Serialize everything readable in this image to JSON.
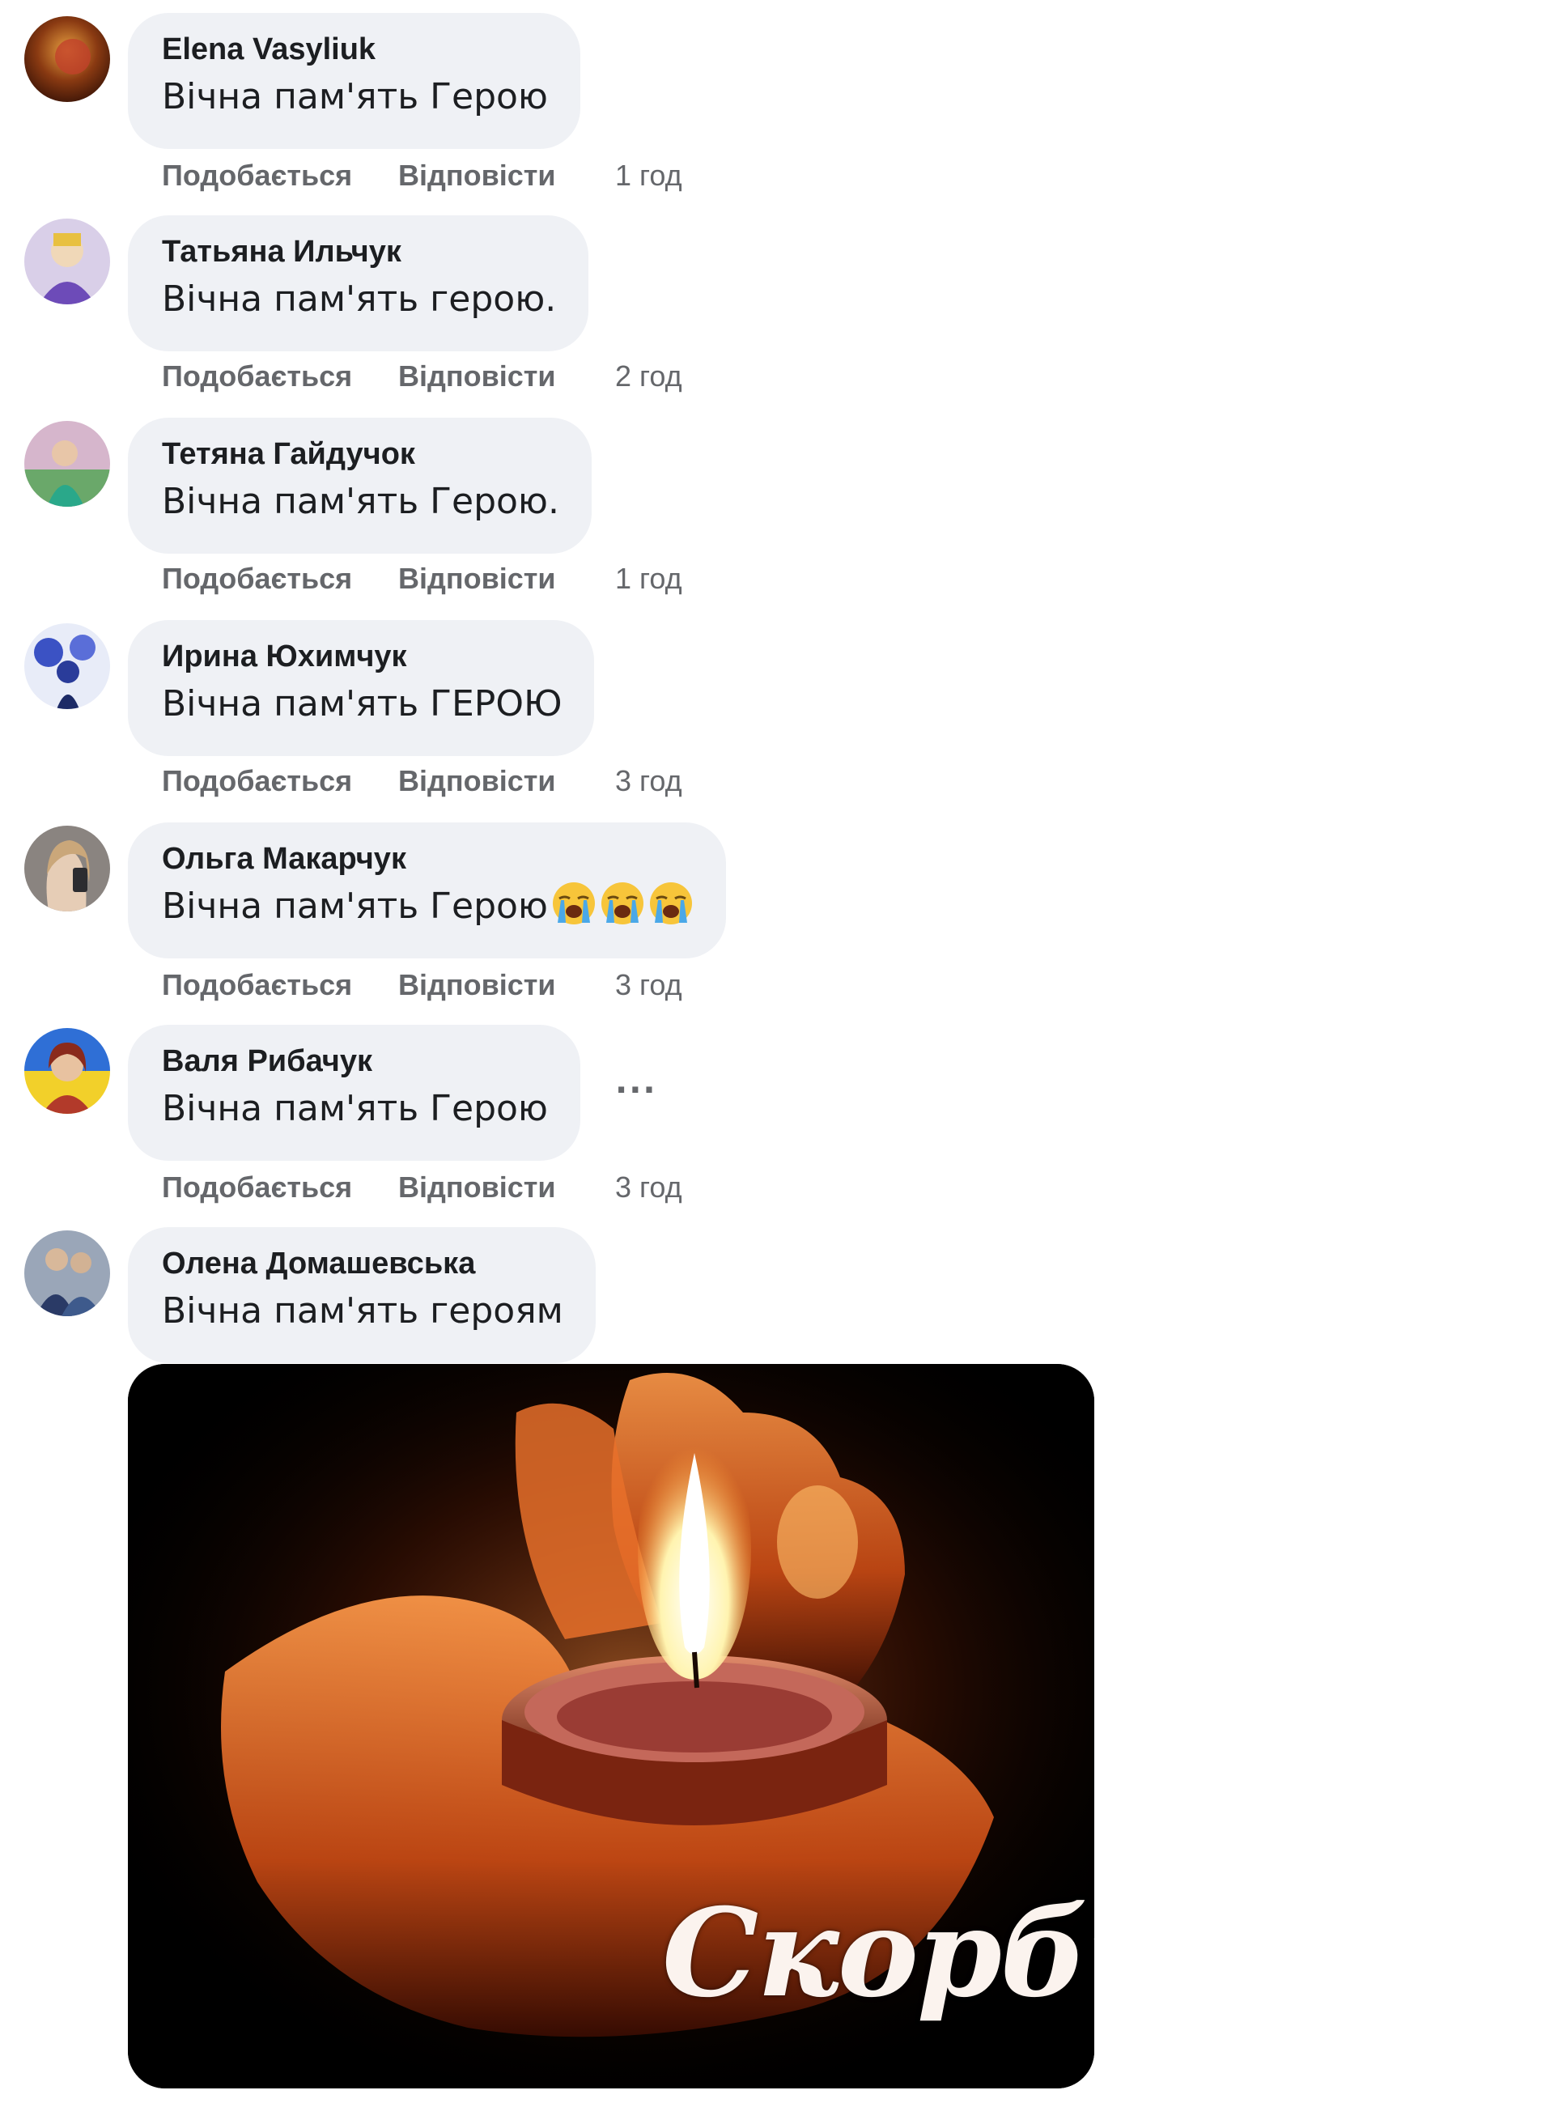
{
  "comments": [
    {
      "author": "Elena Vasyliuk",
      "text": "Вічна пам'ять Герою",
      "like": "Подобається",
      "reply": "Відповісти",
      "time": "1 год",
      "avatar_color": "#8a3a12"
    },
    {
      "author": "Татьяна Ильчук",
      "text": "Вічна пам'ять герою.",
      "like": "Подобається",
      "reply": "Відповісти",
      "time": "2 год",
      "avatar_color": "#6d4bb8"
    },
    {
      "author": "Тетяна Гайдучок",
      "text": "Вічна пам'ять Герою.",
      "like": "Подобається",
      "reply": "Відповісти",
      "time": "1 год",
      "avatar_color": "#2aa88a"
    },
    {
      "author": "Ирина Юхимчук",
      "text": "Вічна пам'ять ГЕРОЮ",
      "like": "Подобається",
      "reply": "Відповісти",
      "time": "3 год",
      "avatar_color": "#3b52c4"
    },
    {
      "author": "Ольга Макарчук",
      "text": "Вічна пам'ять Герою",
      "like": "Подобається",
      "reply": "Відповісти",
      "time": "3 год",
      "avatar_color": "#7a6a62",
      "emoji": [
        "loudly-crying-face",
        "loudly-crying-face",
        "loudly-crying-face"
      ]
    },
    {
      "author": "Валя Рибачук",
      "text": "Вічна пам'ять Герою",
      "like": "Подобається",
      "reply": "Відповісти",
      "time": "3 год",
      "avatar_color": "#d4b33a",
      "more": "···"
    },
    {
      "author": "Олена Домашевська",
      "text": "Вічна пам'ять героям",
      "avatar_color": "#3e5a8c"
    }
  ],
  "gif": {
    "caption": "Скорбим",
    "image": "candle-in-hands"
  },
  "colors": {
    "bubble": "#eff1f5",
    "text": "#1c1e21",
    "secondary": "#65676b"
  }
}
